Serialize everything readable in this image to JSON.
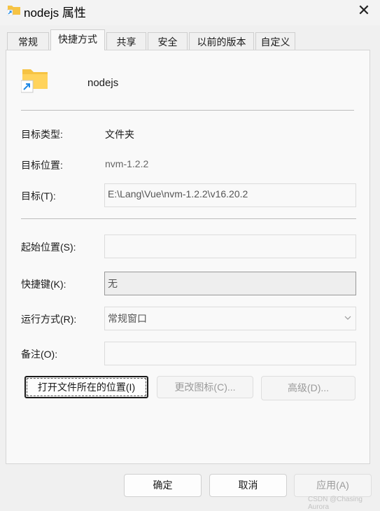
{
  "window": {
    "title": "nodejs 属性",
    "close_glyph": "✕"
  },
  "tabs": [
    {
      "label": "常规"
    },
    {
      "label": "快捷方式"
    },
    {
      "label": "共享"
    },
    {
      "label": "安全"
    },
    {
      "label": "以前的版本"
    },
    {
      "label": "自定义"
    }
  ],
  "shortcut": {
    "name": "nodejs",
    "target_type_label": "目标类型:",
    "target_type_value": "文件夹",
    "target_location_label": "目标位置:",
    "target_location_value": "nvm-1.2.2",
    "target_label": "目标(T):",
    "target_value": "E:\\Lang\\Vue\\nvm-1.2.2\\v16.20.2",
    "start_in_label": "起始位置(S):",
    "start_in_value": "",
    "hotkey_label": "快捷键(K):",
    "hotkey_value": "无",
    "run_label": "运行方式(R):",
    "run_value": "常规窗口",
    "comment_label": "备注(O):",
    "comment_value": ""
  },
  "actions": {
    "open_location": "打开文件所在的位置(I)",
    "change_icon": "更改图标(C)...",
    "advanced": "高级(D)..."
  },
  "footer": {
    "ok": "确定",
    "cancel": "取消",
    "apply": "应用(A)"
  },
  "watermark": "CSDN @Chasing Aurora",
  "icons": {
    "title": "folder-shortcut-icon",
    "big": "folder-shortcut-icon",
    "dropdown": "chevron-down-icon"
  },
  "colors": {
    "folder": "#f6c343",
    "shortcut_arrow": "#1e88e5"
  }
}
